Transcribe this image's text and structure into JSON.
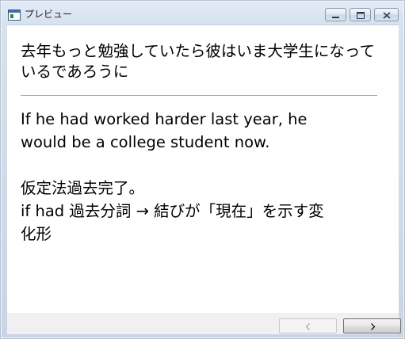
{
  "window": {
    "title": "プレビュー",
    "controls": {
      "minimize_icon": "minimize-icon",
      "maximize_icon": "maximize-icon",
      "close_icon": "close-icon"
    }
  },
  "card": {
    "question": "去年もっと勉強していたら彼はいま大学生になっているであろうに",
    "answer_lines": [
      "If he had worked harder last year, he",
      "would be a college student now.",
      "",
      "仮定法過去完了。",
      "if had 過去分詞 → 結びが「現在」を示す変",
      "化形"
    ]
  },
  "navigation": {
    "prev_icon": "chevron-left-icon",
    "next_icon": "chevron-right-icon"
  },
  "colors": {
    "frame": "#d6e1ef",
    "content_bg": "#ffffff",
    "footer_bg": "#f0f0f0",
    "divider": "#a8a8a8"
  }
}
